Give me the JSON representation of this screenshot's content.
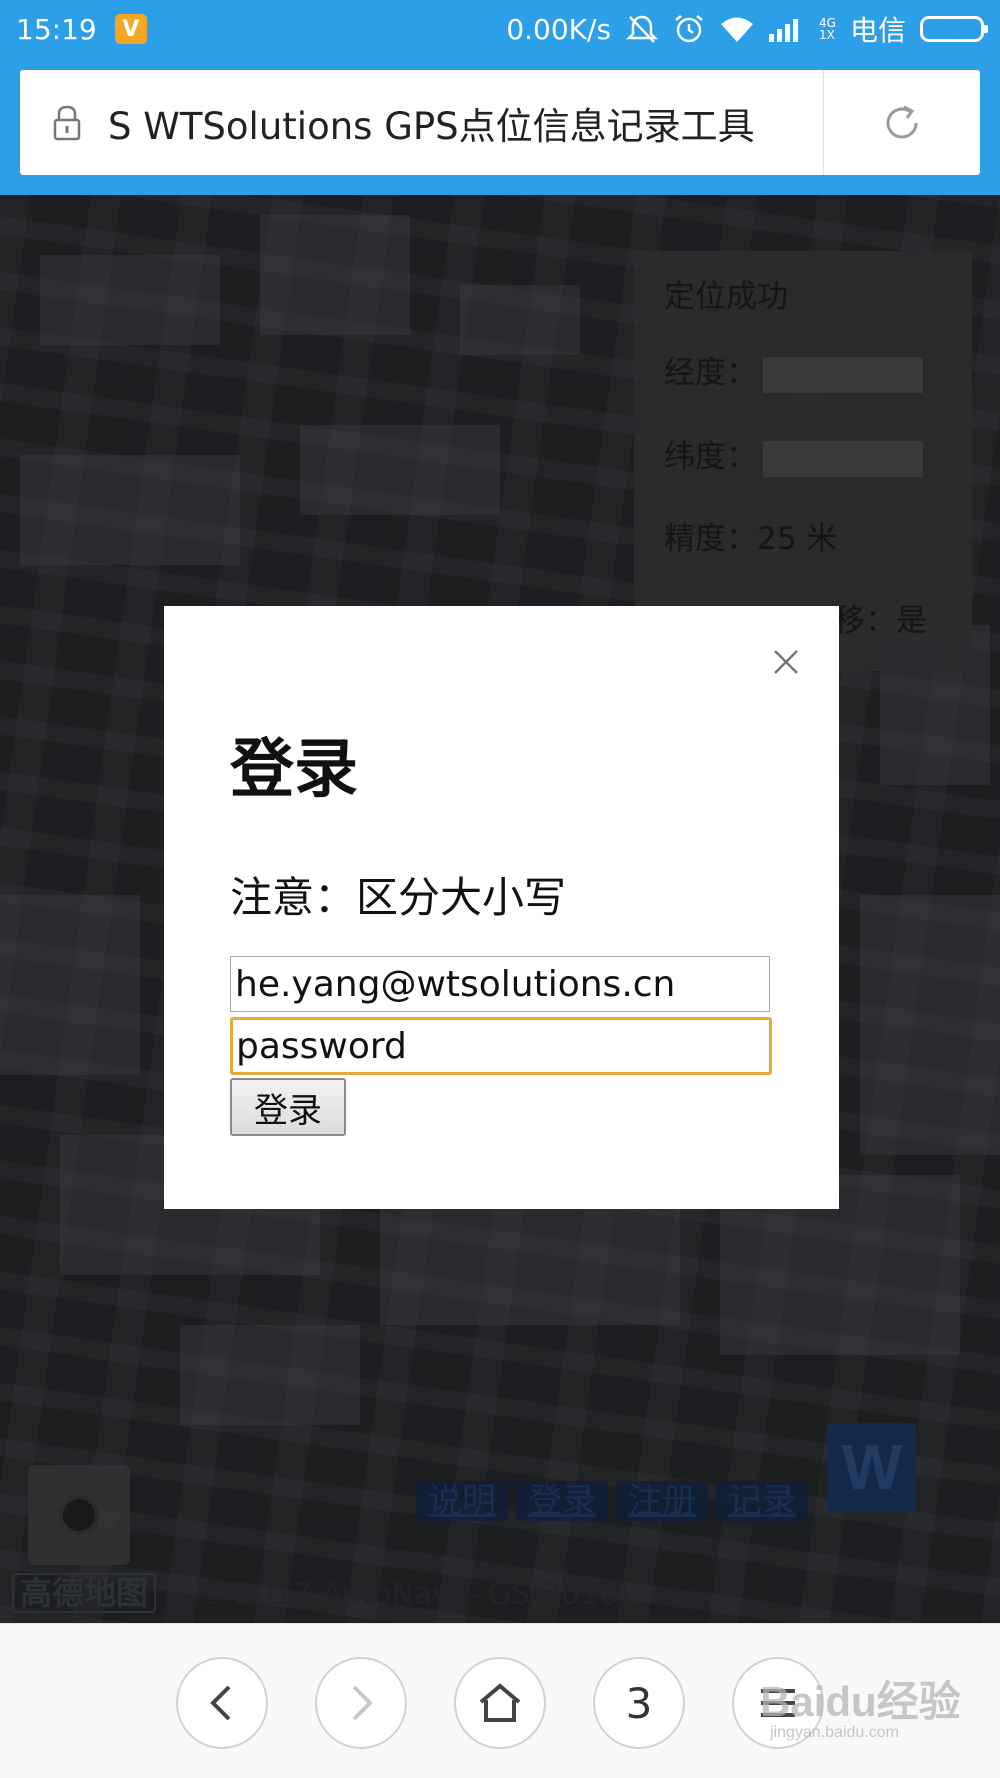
{
  "status_bar": {
    "time": "15:19",
    "app_badge": "V",
    "net_speed": "0.00K/s",
    "net_type_top": "4G",
    "net_type_bottom": "1X",
    "carrier": "电信",
    "icons": [
      "mute-icon",
      "alarm-icon",
      "wifi-icon",
      "signal-icon",
      "battery-icon"
    ]
  },
  "address_bar": {
    "title": "S WTSolutions GPS点位信息记录工具",
    "icons": [
      "lock-icon",
      "reload-icon"
    ]
  },
  "info_panel": {
    "status": "定位成功",
    "longitude_label": "经度：",
    "latitude_label": "纬度：",
    "accuracy": "精度：25 米",
    "offset": "移：是"
  },
  "login_modal": {
    "title": "登录",
    "note": "注意：区分大小写",
    "email_value": "he.yang@wtsolutions.cn",
    "password_value": "password",
    "submit_label": "登录"
  },
  "map_links": [
    "说明",
    "登录",
    "注册",
    "记录"
  ],
  "map_logo_text": "W",
  "map_footer": {
    "amap_logo": "高德地图",
    "copyright": "© 2017 AutoNavi - GS(2016)"
  },
  "bottom_nav": {
    "tabs_count": "3",
    "icons": [
      "back-icon",
      "forward-icon",
      "home-icon",
      "tabs-icon",
      "menu-icon"
    ]
  },
  "watermark": {
    "text": "Baidu经验",
    "sub": "jingyan.baidu.com"
  },
  "colors": {
    "header_blue": "#2c9fe8",
    "focus_orange": "#e8a93c",
    "badge_orange": "#f5a623"
  }
}
